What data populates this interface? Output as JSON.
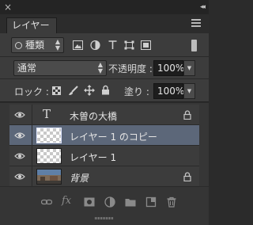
{
  "panel": {
    "close_icon": "close-icon",
    "collapse_icon": "collapse-icon",
    "tab_label": "レイヤー",
    "menu_icon": "panel-menu-icon"
  },
  "filter": {
    "kind_label": "種類",
    "icons": [
      "pixel-filter-icon",
      "adjustment-filter-icon",
      "type-filter-icon",
      "shape-filter-icon",
      "smart-object-filter-icon"
    ]
  },
  "blend": {
    "mode": "通常",
    "opacity_label": "不透明度 :",
    "opacity_value": "100%"
  },
  "lock": {
    "label": "ロック :",
    "fill_label": "塗り :",
    "fill_value": "100%"
  },
  "layers": [
    {
      "name": "木曽の大橋",
      "type": "text",
      "locked": true,
      "selected": false
    },
    {
      "name": "レイヤー 1 のコピー",
      "type": "pixel",
      "locked": false,
      "selected": true
    },
    {
      "name": "レイヤー 1",
      "type": "pixel",
      "locked": false,
      "selected": false
    },
    {
      "name": "背景",
      "type": "image",
      "locked": true,
      "selected": false
    }
  ],
  "footer_icons": [
    "link-layers-icon",
    "fx-icon",
    "add-mask-icon",
    "adjustment-layer-icon",
    "new-group-icon",
    "new-layer-icon",
    "delete-icon"
  ],
  "footer": {
    "fx_label": "fx"
  },
  "colors": {
    "panel_bg": "#3c3c3c",
    "selected_row": "#5c6779"
  }
}
